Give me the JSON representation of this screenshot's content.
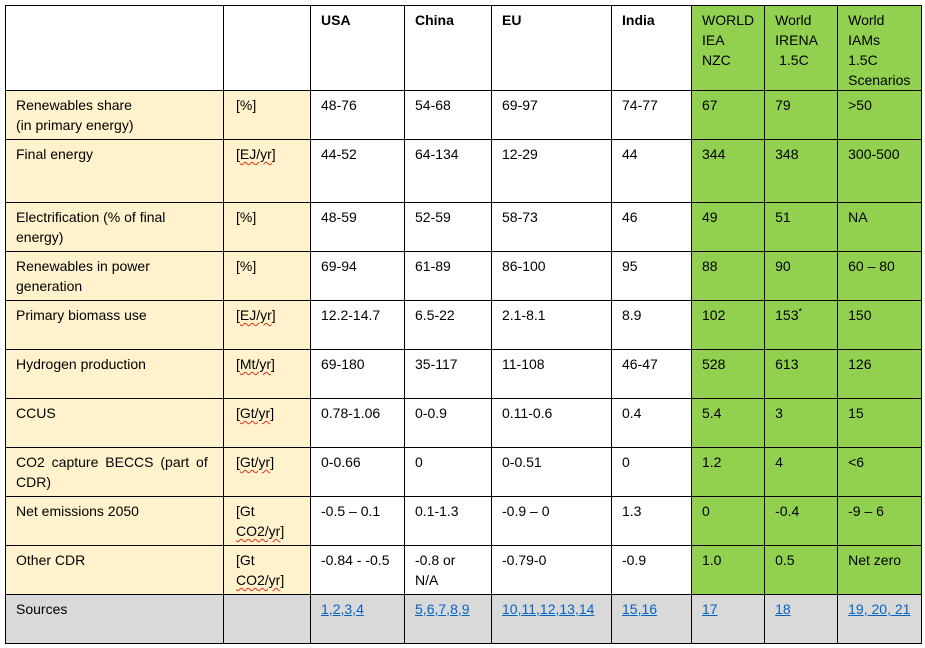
{
  "header": {
    "usa": "USA",
    "china": "China",
    "eu": "EU",
    "india": "India",
    "world_iea": [
      "WORLD",
      "IEA",
      "NZC"
    ],
    "world_irena": [
      "World",
      "IRENA",
      "1.5C"
    ],
    "world_iams": [
      "World",
      "IAMs",
      "1.5C",
      "Scenarios"
    ]
  },
  "rows": [
    {
      "label": [
        "Renewables share",
        "(in primary energy)"
      ],
      "unit": [
        "[%]"
      ],
      "usa": "48-76",
      "china": "54-68",
      "eu": "69-97",
      "india": "74-77",
      "iea": "67",
      "irena": "79",
      "iams": ">50"
    },
    {
      "label": [
        "Final energy"
      ],
      "unit": [
        "[EJ/yr]"
      ],
      "usa": "44-52",
      "china": "64-134",
      "eu": "12-29",
      "india": "44",
      "iea": "344",
      "irena": "348",
      "iams": "300-500"
    },
    {
      "label": [
        "Electrification (% of final",
        "energy)"
      ],
      "unit": [
        "[%]"
      ],
      "usa": "48-59",
      "china": "52-59",
      "eu": "58-73",
      "india": "46",
      "iea": "49",
      "irena": "51",
      "iams": "NA"
    },
    {
      "label": [
        "Renewables in power",
        "generation"
      ],
      "unit": [
        "[%]"
      ],
      "usa": "69-94",
      "china": "61-89",
      "eu": "86-100",
      "india": "95",
      "iea": "88",
      "irena": "90",
      "iams": "60 – 80"
    },
    {
      "label": [
        "Primary biomass use"
      ],
      "unit": [
        "[EJ/yr]"
      ],
      "usa": "12.2-14.7",
      "china": "6.5-22",
      "eu": "2.1-8.1",
      "india": "8.9",
      "iea": "102",
      "irena": "153",
      "irena_sup": "*",
      "iams": "150"
    },
    {
      "label": [
        "Hydrogen production"
      ],
      "unit": [
        "[Mt/yr]"
      ],
      "usa": "69-180",
      "china": "35-117",
      "eu": "11-108",
      "india": "46-47",
      "iea": "528",
      "irena": "613",
      "iams": "126"
    },
    {
      "label": [
        "CCUS"
      ],
      "unit": [
        "[Gt/yr]"
      ],
      "usa": "0.78-1.06",
      "china": "0-0.9",
      "eu": "0.11-0.6",
      "india": "0.4",
      "iea": "5.4",
      "irena": "3",
      "iams": "15"
    },
    {
      "label": [
        "CO2 capture BECCS (part of",
        "CDR)"
      ],
      "unit": [
        "[Gt/yr]"
      ],
      "usa": "0-0.66",
      "china": "0",
      "eu": "0-0.51",
      "india": "0",
      "iea": "1.2",
      "irena": "4",
      "iams": "<6"
    },
    {
      "label": [
        "Net emissions 2050"
      ],
      "unit": [
        "[Gt",
        "CO2/yr]"
      ],
      "usa": "-0.5 – 0.1",
      "china": "0.1-1.3",
      "eu": "-0.9 – 0",
      "india": "1.3",
      "iea": "0",
      "irena": "-0.4",
      "iams": "-9 – 6"
    },
    {
      "label": [
        "Other CDR"
      ],
      "unit": [
        "[Gt",
        "CO2/yr]"
      ],
      "usa": "-0.84 - -0.5",
      "china": "-0.8 or N/A",
      "eu": "-0.79-0",
      "india": "-0.9",
      "iea": "1.0",
      "irena": "0.5",
      "iams": "Net zero"
    }
  ],
  "sources": {
    "label": "Sources",
    "usa": [
      "1",
      "2",
      "3",
      "4"
    ],
    "china": [
      "5",
      "6",
      "7",
      "8",
      "9"
    ],
    "eu": [
      "10",
      "11",
      "12",
      "13",
      "14"
    ],
    "india": [
      "15",
      "16"
    ],
    "iea": [
      "17"
    ],
    "irena": [
      "18"
    ],
    "iams": [
      "19",
      " 20",
      " 21"
    ]
  },
  "colors": {
    "label_bg": "#FFF2CC",
    "world_bg": "#92D050",
    "sources_bg": "#D9D9D9",
    "link": "#0563C1"
  }
}
